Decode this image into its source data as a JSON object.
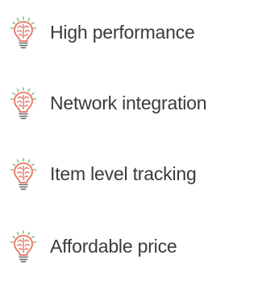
{
  "features": {
    "items": [
      {
        "label": "High performance",
        "icon": "brain-lightbulb-icon"
      },
      {
        "label": "Network integration",
        "icon": "brain-lightbulb-icon"
      },
      {
        "label": "Item level tracking",
        "icon": "brain-lightbulb-icon"
      },
      {
        "label": "Affordable price",
        "icon": "brain-lightbulb-icon"
      }
    ]
  },
  "colors": {
    "bulb_body": "#e87564",
    "bulb_base": "#6b6b6b",
    "rays": "#7cc576",
    "text": "#3a3a3a"
  }
}
